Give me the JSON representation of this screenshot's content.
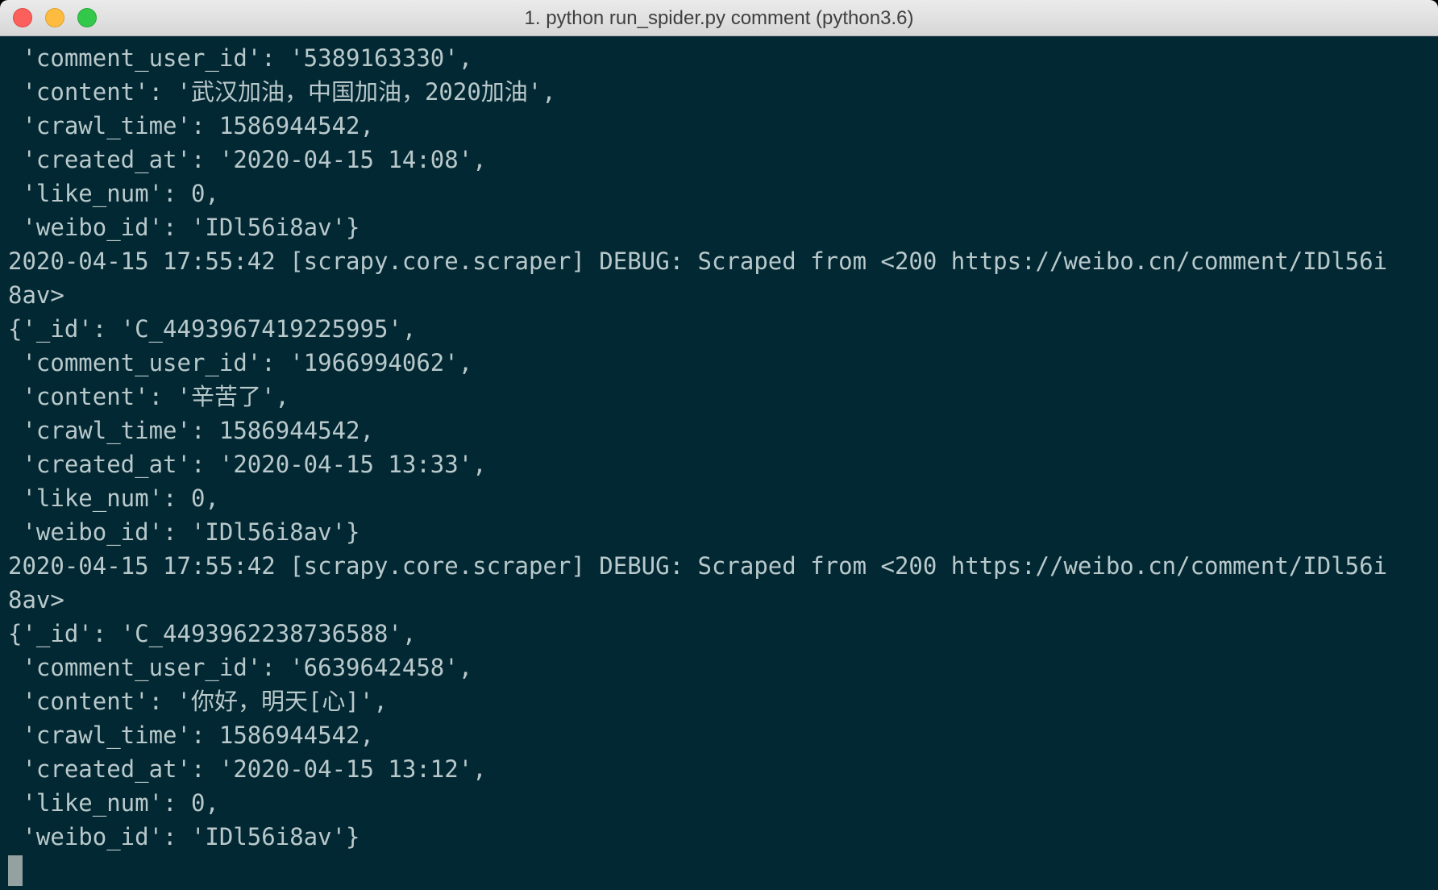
{
  "window": {
    "title": "1. python run_spider.py comment (python3.6)",
    "background_color": "#022833",
    "text_color": "#b9c9cb"
  },
  "terminal": {
    "lines": [
      " 'comment_user_id': '5389163330',",
      " 'content': '武汉加油，中国加油，2020加油',",
      " 'crawl_time': 1586944542,",
      " 'created_at': '2020-04-15 14:08',",
      " 'like_num': 0,",
      " 'weibo_id': 'IDl56i8av'}",
      "2020-04-15 17:55:42 [scrapy.core.scraper] DEBUG: Scraped from <200 https://weibo.cn/comment/IDl56i",
      "8av>",
      "{'_id': 'C_4493967419225995',",
      " 'comment_user_id': '1966994062',",
      " 'content': '辛苦了',",
      " 'crawl_time': 1586944542,",
      " 'created_at': '2020-04-15 13:33',",
      " 'like_num': 0,",
      " 'weibo_id': 'IDl56i8av'}",
      "2020-04-15 17:55:42 [scrapy.core.scraper] DEBUG: Scraped from <200 https://weibo.cn/comment/IDl56i",
      "8av>",
      "{'_id': 'C_4493962238736588',",
      " 'comment_user_id': '6639642458',",
      " 'content': '你好，明天[心]',",
      " 'crawl_time': 1586944542,",
      " 'created_at': '2020-04-15 13:12',",
      " 'like_num': 0,",
      " 'weibo_id': 'IDl56i8av'}"
    ]
  }
}
